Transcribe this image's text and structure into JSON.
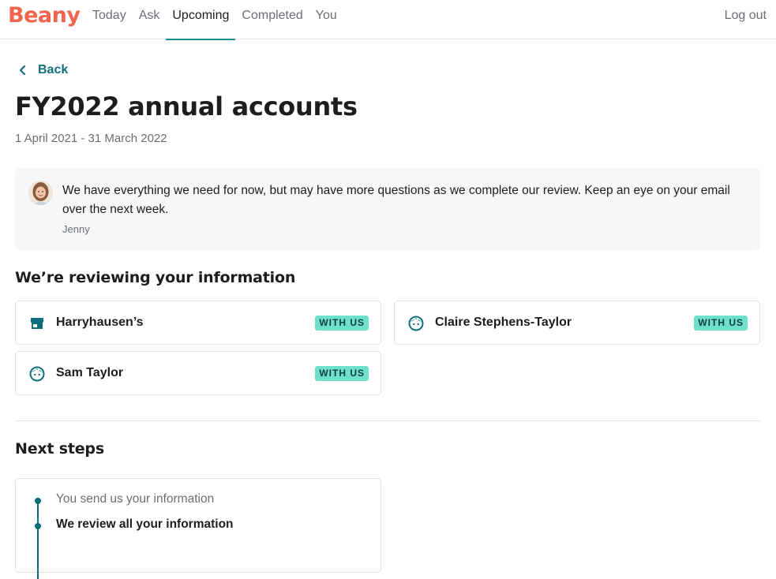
{
  "app": {
    "logo": "Beany"
  },
  "nav": {
    "items": [
      {
        "label": "Today"
      },
      {
        "label": "Ask"
      },
      {
        "label": "Upcoming"
      },
      {
        "label": "Completed"
      },
      {
        "label": "You"
      }
    ],
    "active": "Upcoming",
    "logout": "Log out"
  },
  "header": {
    "back": "Back",
    "title": "FY2022 annual accounts",
    "period": "1 April 2021 - 31 March 2022"
  },
  "message": {
    "text": "We have everything we need for now, but may have more questions as we complete our review. Keep an eye on your email over the next week.",
    "author": "Jenny"
  },
  "reviewing": {
    "title": "We’re reviewing your information",
    "items": [
      {
        "name": "Harryhausen’s",
        "icon": "store-icon",
        "status": "WITH US"
      },
      {
        "name": "Claire Stephens-Taylor",
        "icon": "person-icon",
        "status": "WITH US"
      },
      {
        "name": "Sam Taylor",
        "icon": "person-icon",
        "status": "WITH US"
      }
    ]
  },
  "next_steps": {
    "title": "Next steps",
    "steps": [
      {
        "label": "You send us your information",
        "state": "done"
      },
      {
        "label": "We review all your information",
        "state": "current"
      }
    ]
  },
  "colors": {
    "brand": "#f0644e",
    "accent": "#0f6e7c",
    "badge": "#6fe0c9"
  }
}
